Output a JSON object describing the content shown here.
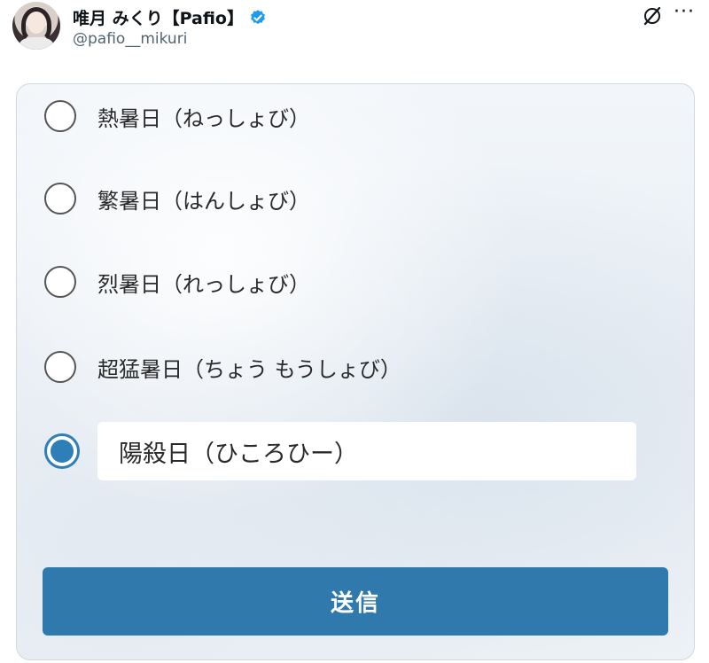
{
  "post": {
    "author_name": "唯月 みくり【Pafio】",
    "handle": "@pafio__mikuri"
  },
  "form": {
    "options": [
      {
        "label": "熱暑日（ねっしょび）",
        "selected": false
      },
      {
        "label": "繁暑日（はんしょび）",
        "selected": false
      },
      {
        "label": "烈暑日（れっしょび）",
        "selected": false
      },
      {
        "label": "超猛暑日（ちょう もうしょび）",
        "selected": false
      },
      {
        "label": "",
        "selected": true
      }
    ],
    "custom_input_value": "陽殺日（ひころひー）",
    "submit_label": "送信"
  },
  "colors": {
    "accent": "#2f79ad",
    "verified_badge": "#1d9bf0"
  },
  "icons": [
    "verified-badge-icon",
    "grok-icon",
    "more-icon"
  ]
}
